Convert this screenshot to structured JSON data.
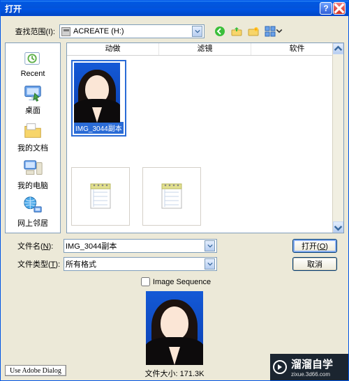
{
  "title": "打开",
  "look_in_label": "查找范围(I):",
  "look_in_value": "ACREATE (H:)",
  "nav": {
    "back_icon": "back",
    "up_icon": "up-one-level",
    "new_folder_icon": "new-folder",
    "view_icon": "view-menu",
    "toolbox_icon": "camera-toolbox"
  },
  "places": [
    {
      "label": "Recent",
      "icon": "recent"
    },
    {
      "label": "桌面",
      "icon": "desktop"
    },
    {
      "label": "我的文档",
      "icon": "documents"
    },
    {
      "label": "我的电脑",
      "icon": "computer"
    },
    {
      "label": "网上邻居",
      "icon": "network"
    }
  ],
  "columns": [
    "动做",
    "滤镜",
    "软件"
  ],
  "items": {
    "selected_image": {
      "label": "IMG_3044副本"
    },
    "doc1": {
      "label": ""
    },
    "doc2": {
      "label": ""
    }
  },
  "file_name_label": "文件名(N):",
  "file_name_value": "IMG_3044副本",
  "file_type_label": "文件类型(T):",
  "file_type_value": "所有格式",
  "open_button": "打开(O)",
  "cancel_button": "取消",
  "sequence_label": "Image Sequence",
  "preview": {
    "file_size_label": "文件大小:",
    "file_size_value": "171.3K"
  },
  "watermark": {
    "brand": "溜溜自学",
    "sub": "zixue.3d66.com"
  },
  "adobe_dialog_btn": "Use Adobe Dialog"
}
